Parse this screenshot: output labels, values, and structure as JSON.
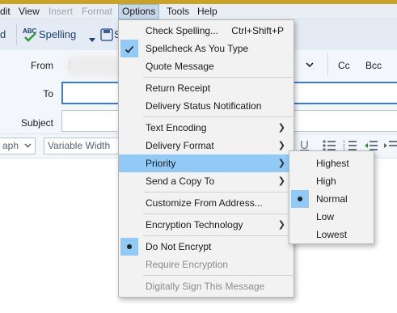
{
  "menubar": {
    "items": [
      {
        "label": "dit",
        "disabled": false
      },
      {
        "label": "View",
        "disabled": false
      },
      {
        "label": "Insert",
        "disabled": true
      },
      {
        "label": "Format",
        "disabled": true
      },
      {
        "label": "Options",
        "disabled": false,
        "open": true
      },
      {
        "label": "Tools",
        "disabled": false
      },
      {
        "label": "Help",
        "disabled": false
      }
    ]
  },
  "toolbar": {
    "send_fragment": "d",
    "spelling_label": "Spelling",
    "save_fragment": "S"
  },
  "header": {
    "from_label": "From",
    "from_fragment": "S",
    "cc_label": "Cc",
    "bcc_label": "Bcc",
    "to_label": "To",
    "subject_label": "Subject"
  },
  "format_bar": {
    "paragraph_fragment": "aph",
    "font_value": "Variable Width"
  },
  "options_menu": {
    "check_spelling": "Check Spelling...",
    "check_spelling_shortcut": "Ctrl+Shift+P",
    "spellcheck_as_you_type": "Spellcheck As You Type",
    "quote_message": "Quote Message",
    "return_receipt": "Return Receipt",
    "delivery_status": "Delivery Status Notification",
    "text_encoding": "Text Encoding",
    "delivery_format": "Delivery Format",
    "priority": "Priority",
    "send_copy_to": "Send a Copy To",
    "customize_from": "Customize From Address...",
    "encryption_technology": "Encryption Technology",
    "do_not_encrypt": "Do Not Encrypt",
    "require_encryption": "Require Encryption",
    "digitally_sign": "Digitally Sign This Message"
  },
  "priority_menu": {
    "highest": "Highest",
    "high": "High",
    "normal": "Normal",
    "low": "Low",
    "lowest": "Lowest",
    "selected": "Normal"
  },
  "colors": {
    "highlight": "#91c9f7",
    "menubar": "#e9eef5",
    "accent": "#3a7bd5"
  }
}
